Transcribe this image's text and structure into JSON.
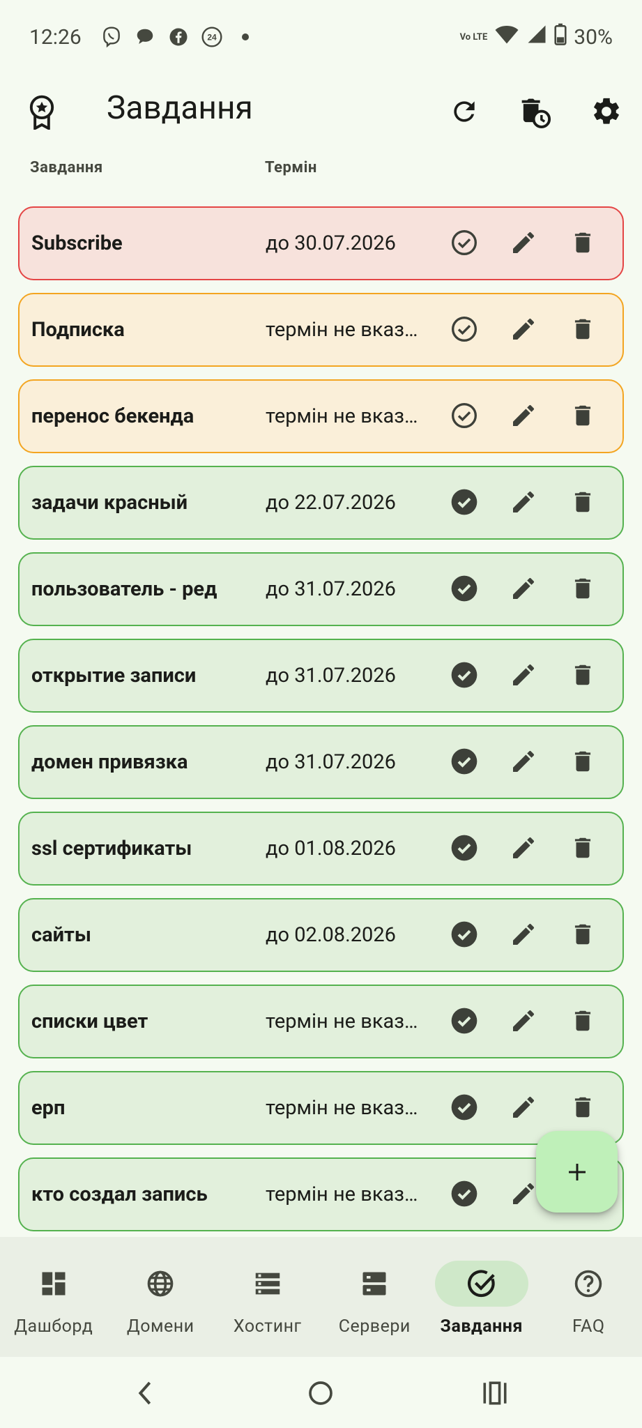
{
  "status": {
    "time": "12:26",
    "volte": "Vo LTE",
    "battery": "30%"
  },
  "app_bar": {
    "title": "Завдання",
    "icons": [
      "badge-icon",
      "refresh-icon",
      "delete-history-icon",
      "settings-icon"
    ]
  },
  "columns": {
    "task": "Завдання",
    "deadline": "Термін"
  },
  "tasks": [
    {
      "name": "Subscribe",
      "deadline": "до 30.07.2026",
      "state": "overdue",
      "done": false
    },
    {
      "name": "Подписка",
      "deadline": "термін не вказано",
      "state": "nodate",
      "done": false
    },
    {
      "name": "перенос бекенда",
      "deadline": "термін не вказано",
      "state": "nodate",
      "done": false
    },
    {
      "name": "задачи красный",
      "deadline": "до 22.07.2026",
      "state": "done",
      "done": true
    },
    {
      "name": "пользователь - ред",
      "deadline": "до 31.07.2026",
      "state": "done",
      "done": true
    },
    {
      "name": "открытие записи",
      "deadline": "до 31.07.2026",
      "state": "done",
      "done": true
    },
    {
      "name": "домен привязка",
      "deadline": "до 31.07.2026",
      "state": "done",
      "done": true
    },
    {
      "name": "ssl сертификаты",
      "deadline": "до 01.08.2026",
      "state": "done",
      "done": true
    },
    {
      "name": "сайты",
      "deadline": "до 02.08.2026",
      "state": "done",
      "done": true
    },
    {
      "name": "списки цвет",
      "deadline": "термін не вказано",
      "state": "done",
      "done": true
    },
    {
      "name": "ерп",
      "deadline": "термін не вказано",
      "state": "done",
      "done": true
    },
    {
      "name": "кто создал запись",
      "deadline": "термін не вказано",
      "state": "done",
      "done": true
    }
  ],
  "nav": {
    "items": [
      {
        "label": "Дашборд",
        "icon": "dashboard-icon",
        "active": false
      },
      {
        "label": "Домени",
        "icon": "globe-icon",
        "active": false
      },
      {
        "label": "Хостинг",
        "icon": "list-icon",
        "active": false
      },
      {
        "label": "Сервери",
        "icon": "server-icon",
        "active": false
      },
      {
        "label": "Завдання",
        "icon": "task-check-icon",
        "active": true
      },
      {
        "label": "FAQ",
        "icon": "help-icon",
        "active": false
      }
    ]
  },
  "colors": {
    "overdue_bg": "#f7e2dc",
    "overdue_border": "#e44545",
    "nodate_bg": "#faefd9",
    "nodate_border": "#f3a521",
    "done_bg": "#e2f0dc",
    "done_border": "#55b24f",
    "fab": "#bff0b9"
  }
}
